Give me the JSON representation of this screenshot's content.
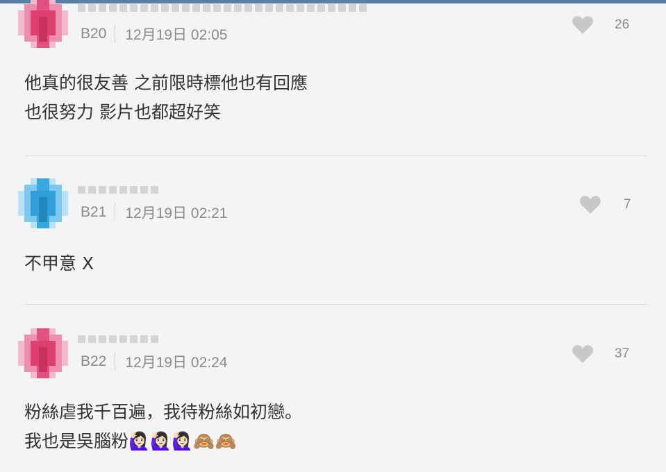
{
  "comments": [
    {
      "floor": "B20",
      "time": "12月19日 02:05",
      "likes": "26",
      "lines": [
        "他真的很友善 之前限時標他也有回應",
        "也很努力 影片也都超好笑"
      ],
      "avatar_color": "#e2517f"
    },
    {
      "floor": "B21",
      "time": "12月19日 02:21",
      "likes": "7",
      "lines": [
        "不甲意 X"
      ],
      "avatar_color": "#2f9fd9"
    },
    {
      "floor": "B22",
      "time": "12月19日 02:24",
      "likes": "37",
      "lines": [
        "粉絲虐我千百遍，我待粉絲如初戀。",
        "我也是吳腦粉🙋🏻‍♀️🙋🏻‍♀️🙋🏻‍♀️🙈🙈"
      ],
      "avatar_color": "#e2517f"
    }
  ],
  "colors": {
    "background": "#f4f4f4",
    "text": "#333333",
    "meta": "#8a8a8a",
    "heart": "#c8c8c8",
    "top_strip": "#5a7fa6"
  },
  "icons": {
    "like": "heart-icon"
  }
}
